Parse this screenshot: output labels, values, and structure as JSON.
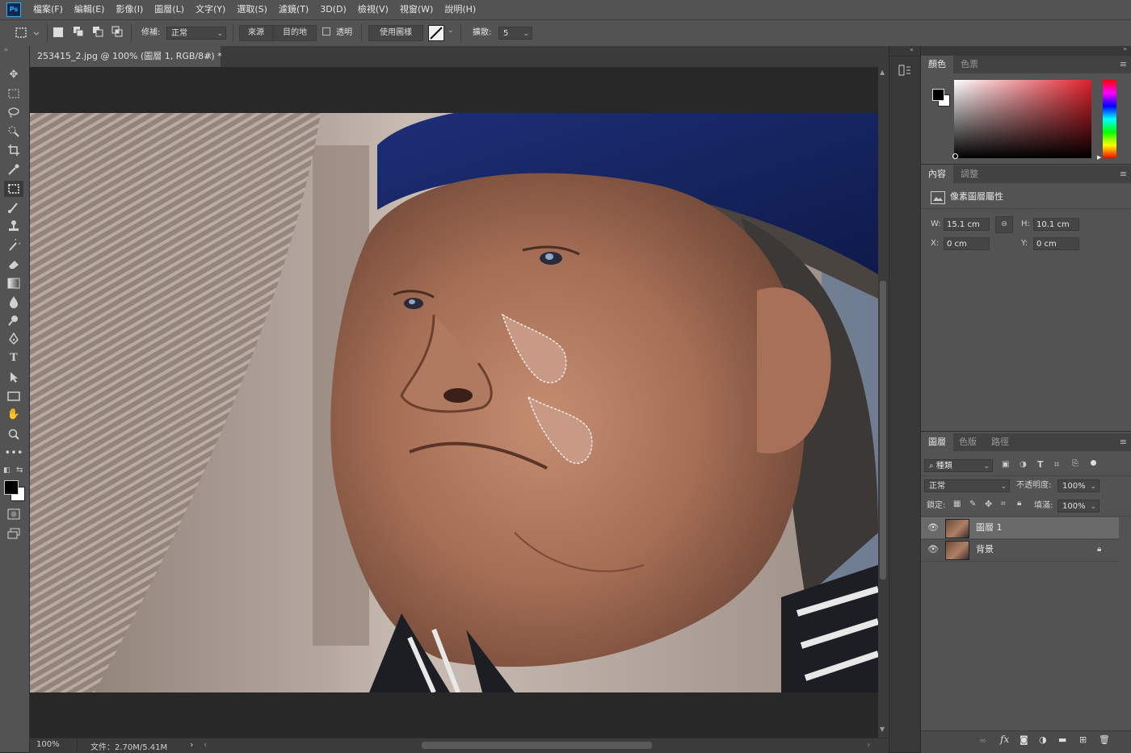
{
  "app": {
    "logo": "Ps"
  },
  "menu": [
    "檔案(F)",
    "編輯(E)",
    "影像(I)",
    "圖層(L)",
    "文字(Y)",
    "選取(S)",
    "濾鏡(T)",
    "3D(D)",
    "檢視(V)",
    "視窗(W)",
    "說明(H)"
  ],
  "options": {
    "patch_label": "修補:",
    "patch_mode": "正常",
    "source": "來源",
    "destination": "目的地",
    "transparent": "透明",
    "use_pattern": "使用圖樣",
    "diffusion_label": "擴散:",
    "diffusion_value": "5"
  },
  "document": {
    "tab_title": "253415_2.jpg @ 100% (圖層 1, RGB/8#) *",
    "zoom": "100%",
    "file_info": "文件：2.70M/5.41M"
  },
  "color_panel": {
    "tabs": [
      "顏色",
      "色票"
    ]
  },
  "properties_panel": {
    "tabs": [
      "內容",
      "調整"
    ],
    "title": "像素圖層屬性",
    "w_label": "W:",
    "w_value": "15.1 cm",
    "h_label": "H:",
    "h_value": "10.1 cm",
    "x_label": "X:",
    "x_value": "0 cm",
    "y_label": "Y:",
    "y_value": "0 cm"
  },
  "layers_panel": {
    "tabs": [
      "圖層",
      "色版",
      "路徑"
    ],
    "filter_kind": "種類",
    "blend_mode": "正常",
    "opacity_label": "不透明度:",
    "opacity_value": "100%",
    "lock_label": "鎖定:",
    "fill_label": "填滿:",
    "fill_value": "100%",
    "layers": [
      {
        "name": "圖層 1",
        "selected": true,
        "locked": false
      },
      {
        "name": "背景",
        "selected": false,
        "locked": true
      }
    ]
  },
  "colors": {
    "accent": "#31a8ff",
    "panel": "#535353",
    "background": "#282828"
  }
}
